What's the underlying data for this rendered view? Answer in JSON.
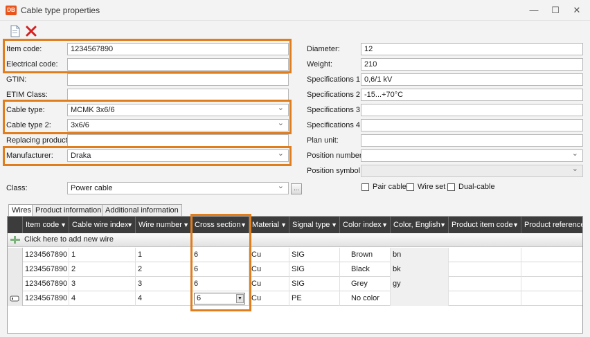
{
  "window": {
    "app_badge": "DB",
    "title": "Cable type properties",
    "minimize": "—",
    "maximize": "☐",
    "close": "✕"
  },
  "toolbar": {
    "new_icon": "document-icon",
    "delete_icon": "red-x-icon"
  },
  "left_fields": {
    "item_code": {
      "label": "Item code:",
      "value": "1234567890"
    },
    "electrical_code": {
      "label": "Electrical code:",
      "value": ""
    },
    "gtin": {
      "label": "GTIN:",
      "value": ""
    },
    "etim_class": {
      "label": "ETIM Class:",
      "value": ""
    },
    "cable_type": {
      "label": "Cable type:",
      "value": "MCMK 3x6/6"
    },
    "cable_type_2": {
      "label": "Cable type 2:",
      "value": "3x6/6"
    },
    "replacing_product": {
      "label": "Replacing product:",
      "value": ""
    },
    "manufacturer": {
      "label": "Manufacturer:",
      "value": "Draka"
    },
    "class": {
      "label": "Class:",
      "value": "Power cable",
      "button": "..."
    }
  },
  "right_fields": {
    "diameter": {
      "label": "Diameter:",
      "value": "12"
    },
    "weight": {
      "label": "Weight:",
      "value": "210"
    },
    "spec1": {
      "label": "Specifications 1:",
      "value": "0,6/1 kV"
    },
    "spec2": {
      "label": "Specifications 2:",
      "value": "-15...+70°C"
    },
    "spec3": {
      "label": "Specifications 3:",
      "value": ""
    },
    "spec4": {
      "label": "Specifications 4:",
      "value": ""
    },
    "plan_unit": {
      "label": "Plan unit:",
      "value": ""
    },
    "position_number": {
      "label": "Position number:",
      "value": ""
    },
    "position_symbol": {
      "label": "Position symbol:",
      "value": ""
    }
  },
  "checkboxes": {
    "pair_cable": {
      "label": "Pair cable",
      "checked": false
    },
    "wire_set": {
      "label": "Wire set",
      "checked": false
    },
    "dual_cable": {
      "label": "Dual-cable",
      "checked": false
    }
  },
  "tabs": [
    "Wires",
    "Product information",
    "Additional information"
  ],
  "grid": {
    "columns": [
      "Item code",
      "Cable wire index",
      "Wire number",
      "Cross section",
      "Material",
      "Signal type",
      "Color index",
      "Color, English",
      "Product item code",
      "Product reference"
    ],
    "add_row_text": "Click here to add new wire",
    "rows": [
      [
        "1234567890",
        "1",
        "1",
        "6",
        "Cu",
        "SIG",
        "Brown",
        "bn",
        "",
        ""
      ],
      [
        "1234567890",
        "2",
        "2",
        "6",
        "Cu",
        "SIG",
        "Black",
        "bk",
        "",
        ""
      ],
      [
        "1234567890",
        "3",
        "3",
        "6",
        "Cu",
        "SIG",
        "Grey",
        "gy",
        "",
        ""
      ],
      [
        "1234567890",
        "4",
        "4",
        "6",
        "Cu",
        "PE",
        "No color",
        "",
        "",
        ""
      ]
    ]
  },
  "colors": {
    "highlight": "#e07d1d",
    "header_bg": "#3c3c3c",
    "app_badge": "#e8541c"
  }
}
